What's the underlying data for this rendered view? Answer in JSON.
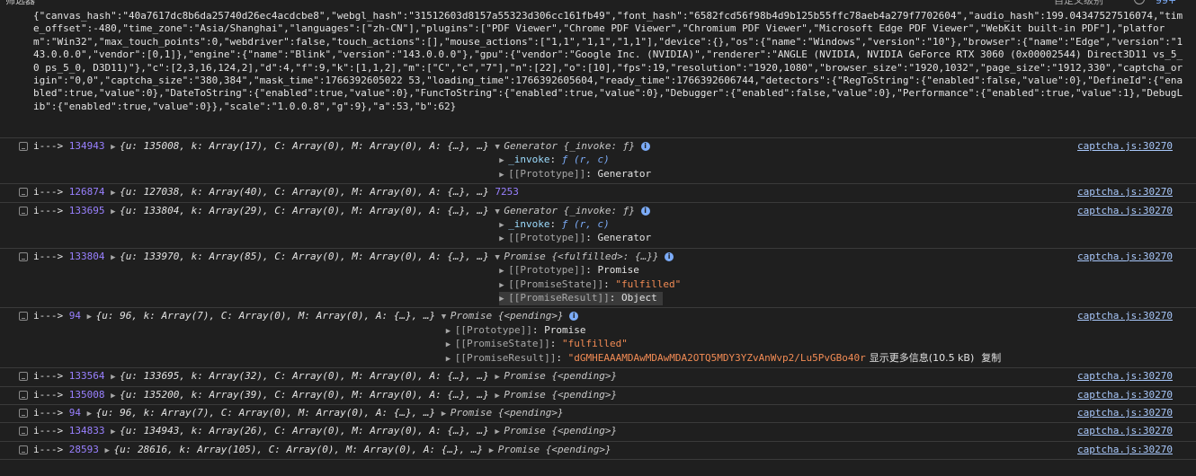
{
  "toolbar": {
    "filter_placeholder": "筛选器",
    "levels_label": "自定义级别",
    "issues_badge": "99+"
  },
  "json_text": "{\"canvas_hash\":\"40a7617dc8b6da25740d26ec4acdcbe8\",\"webgl_hash\":\"31512603d8157a55323d306cc161fb49\",\"font_hash\":\"6582fcd56f98b4d9b125b55ffc78aeb4a279f7702604\",\"audio_hash\":199.04347527516074,\"time_offset\":-480,\"time_zone\":\"Asia/Shanghai\",\"languages\":[\"zh-CN\"],\"plugins\":[\"PDF Viewer\",\"Chrome PDF Viewer\",\"Chromium PDF Viewer\",\"Microsoft Edge PDF Viewer\",\"WebKit built-in PDF\"],\"platform\":\"Win32\",\"max_touch_points\":0,\"webdriver\":false,\"touch_actions\":[],\"mouse_actions\":[\"1,1\",\"1,1\",\"1,1\"],\"device\":{},\"os\":{\"name\":\"Windows\",\"version\":\"10\"},\"browser\":{\"name\":\"Edge\",\"version\":\"143.0.0.0\",\"vendor\":[0,1]},\"engine\":{\"name\":\"Blink\",\"version\":\"143.0.0.0\"},\"gpu\":{\"vendor\":\"Google Inc. (NVIDIA)\",\"renderer\":\"ANGLE (NVIDIA, NVIDIA GeForce RTX 3060 (0x00002544) Direct3D11 vs_5_0 ps_5_0, D3D11)\"},\"c\":[2,3,16,124,2],\"d\":4,\"f\":9,\"k\":[1,1,2],\"m\":[\"C\",\"c\",\"7\"],\"n\":[22],\"o\":[10],\"fps\":19,\"resolution\":\"1920,1080\",\"browser_size\":\"1920,1032\",\"page_size\":\"1912,330\",\"captcha_origin\":\"0,0\",\"captcha_size\":\"380,384\",\"mask_time\":1766392605022 53,\"loading_time\":1766392605604,\"ready_time\":1766392606744,\"detectors\":{\"RegToString\":{\"enabled\":false,\"value\":0},\"DefineId\":{\"enabled\":true,\"value\":0},\"DateToString\":{\"enabled\":true,\"value\":0},\"FuncToString\":{\"enabled\":true,\"value\":0},\"Debugger\":{\"enabled\":false,\"value\":0},\"Performance\":{\"enabled\":true,\"value\":1},\"DebugLib\":{\"enabled\":true,\"value\":0}},\"scale\":\"1.0.0.8\",\"g\":9},\"a\":53,\"b\":62}",
  "entries": [
    {
      "prefix": "i--->",
      "id": "134943",
      "obj": "{u: 135008, k: Array(17), C: Array(0), M: Array(0), A: {…}, …}",
      "src": "captcha.js:30270",
      "result": "Generator {_invoke: ƒ}",
      "props": [
        {
          "name": "_invoke",
          "value": "ƒ (r, c)"
        },
        {
          "name": "[[Prototype]]",
          "value": "Generator"
        }
      ]
    },
    {
      "prefix": "i--->",
      "id": "126874",
      "obj": "{u: 127038, k: Array(40), C: Array(0), M: Array(0), A: {…}, …}",
      "src": "captcha.js:30270",
      "plain": "7253"
    },
    {
      "prefix": "i--->",
      "id": "133695",
      "obj": "{u: 133804, k: Array(29), C: Array(0), M: Array(0), A: {…}, …}",
      "src": "captcha.js:30270",
      "result": "Generator {_invoke: ƒ}",
      "props": [
        {
          "name": "_invoke",
          "value": "ƒ (r, c)"
        },
        {
          "name": "[[Prototype]]",
          "value": "Generator"
        }
      ]
    },
    {
      "prefix": "i--->",
      "id": "133804",
      "obj": "{u: 133970, k: Array(85), C: Array(0), M: Array(0), A: {…}, …}",
      "src": "captcha.js:30270",
      "result": "Promise {<fulfilled>: {…}}",
      "props": [
        {
          "name": "[[Prototype]]",
          "value": "Promise"
        },
        {
          "name": "[[PromiseState]]",
          "value": "\"fulfilled\""
        },
        {
          "name": "[[PromiseResult]]",
          "value": "Object"
        }
      ]
    },
    {
      "prefix": "i--->",
      "id": "94",
      "obj": "{u: 96, k: Array(7), C: Array(0), M: Array(0), A: {…}, …}",
      "src": "captcha.js:30270",
      "result": "Promise {<pending>}",
      "props": [
        {
          "name": "[[Prototype]]",
          "value": "Promise"
        },
        {
          "name": "[[PromiseState]]",
          "value": "\"fulfilled\""
        },
        {
          "name": "[[PromiseResult]]",
          "value": "\"dGMHEAAAMDAwMDAwMDA2OTQ5MDY3YZvAnWvp2/Lu5PvGBo40r"
        }
      ],
      "show_more": "显示更多信息(10.5 kB)",
      "copy": "复制"
    },
    {
      "prefix": "i--->",
      "id": "133564",
      "obj": "{u: 133695, k: Array(32), C: Array(0), M: Array(0), A: {…}, …}",
      "src": "captcha.js:30270",
      "collapsed": "Promise {<pending>}"
    },
    {
      "prefix": "i--->",
      "id": "135008",
      "obj": "{u: 135200, k: Array(39), C: Array(0), M: Array(0), A: {…}, …}",
      "src": "captcha.js:30270",
      "collapsed": "Promise {<pending>}"
    },
    {
      "prefix": "i--->",
      "id": "94",
      "obj": "{u: 96, k: Array(7), C: Array(0), M: Array(0), A: {…}, …}",
      "src": "captcha.js:30270",
      "collapsed": "Promise {<pending>}"
    },
    {
      "prefix": "i--->",
      "id": "134833",
      "obj": "{u: 134943, k: Array(26), C: Array(0), M: Array(0), A: {…}, …}",
      "src": "captcha.js:30270",
      "collapsed": "Promise {<pending>}"
    },
    {
      "prefix": "i--->",
      "id": "28593",
      "obj": "{u: 28616, k: Array(105), C: Array(0), M: Array(0), A: {…}, …}",
      "src": "captcha.js:30270",
      "collapsed": "Promise {<pending>}"
    }
  ]
}
